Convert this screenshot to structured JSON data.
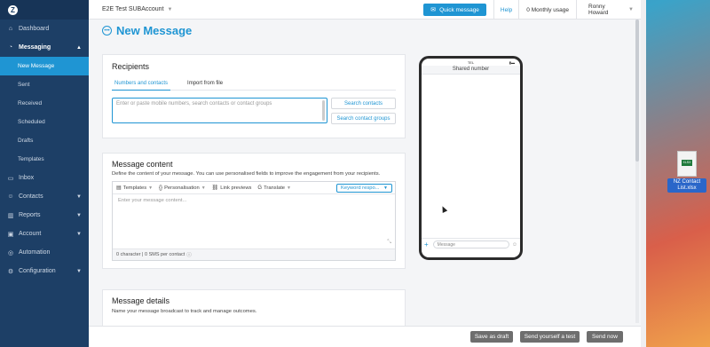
{
  "sidebar": {
    "logo": "Z",
    "items": [
      {
        "label": "Dashboard",
        "icon": "home-icon"
      },
      {
        "label": "Messaging",
        "icon": "chat-icon"
      },
      {
        "label": "Inbox",
        "icon": "inbox-icon"
      },
      {
        "label": "Contacts",
        "icon": "contacts-icon"
      },
      {
        "label": "Reports",
        "icon": "reports-icon"
      },
      {
        "label": "Account",
        "icon": "account-icon"
      },
      {
        "label": "Automation",
        "icon": "automation-icon"
      },
      {
        "label": "Configuration",
        "icon": "gear-icon"
      }
    ],
    "messaging_sub": [
      "New Message",
      "Sent",
      "Received",
      "Scheduled",
      "Drafts",
      "Templates"
    ]
  },
  "topbar": {
    "account": "E2E Test SUBAccount",
    "quick_message": "Quick message",
    "help": "Help",
    "usage": "0 Monthly usage",
    "user": "Ronny Howard"
  },
  "page_title": "New Message",
  "recipients": {
    "title": "Recipients",
    "tabs": [
      "Numbers and contacts",
      "Import from file"
    ],
    "placeholder": "Enter or paste mobile numbers, search contacts or contact groups",
    "search_contacts": "Search contacts",
    "search_groups": "Search contact groups"
  },
  "content": {
    "title": "Message content",
    "description": "Define the content of your message. You can use personalised fields to improve the engagement from your recipients.",
    "toolbar": {
      "templates": "Templates",
      "personalisation": "Personalisation",
      "link_previews": "Link previews",
      "translate": "Translate",
      "keyword": "Keyword respo..."
    },
    "placeholder": "Enter your message content...",
    "footer": "0 character | 0 SMS per contact"
  },
  "details": {
    "title": "Message details",
    "description": "Name your message broadcast to track and manage outcomes."
  },
  "phone": {
    "carrier": "TEL",
    "header": "Shared number",
    "message_placeholder": "Message"
  },
  "actions": {
    "save_draft": "Save as draft",
    "send_test": "Send yourself a test",
    "send_now": "Send now"
  },
  "desktop_file": {
    "name": "NZ Contact List.xlsx",
    "tag": "XLSX"
  },
  "colors": {
    "accent": "#1f95d3",
    "sidebar": "#1d3f66",
    "button_dark": "#6e6e6e"
  }
}
